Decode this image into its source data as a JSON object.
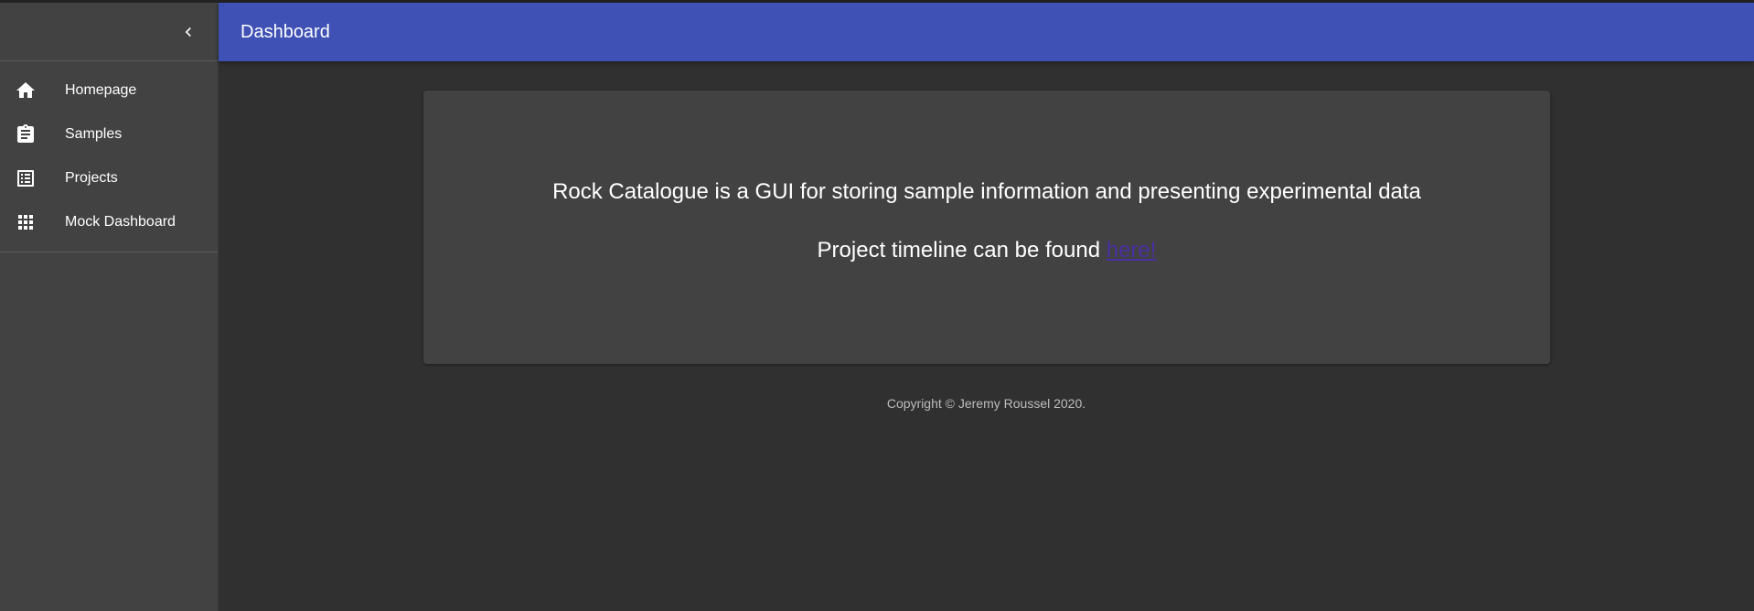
{
  "header": {
    "title": "Dashboard"
  },
  "sidebar": {
    "collapse_icon": "chevron-left-icon",
    "items": [
      {
        "label": "Homepage",
        "icon": "home-icon"
      },
      {
        "label": "Samples",
        "icon": "clipboard-icon"
      },
      {
        "label": "Projects",
        "icon": "checklist-icon"
      },
      {
        "label": "Mock Dashboard",
        "icon": "apps-grid-icon"
      }
    ]
  },
  "main": {
    "description": "Rock Catalogue is a GUI for storing sample information and presenting experimental data",
    "timeline_text": "Project timeline can be found ",
    "timeline_link": "here!",
    "copyright": "Copyright © Jeremy Roussel 2020."
  },
  "colors": {
    "appbar": "#3f51b5",
    "sidebar": "#424242",
    "background": "#303030",
    "card": "#424242",
    "link": "#4a2fa3"
  }
}
